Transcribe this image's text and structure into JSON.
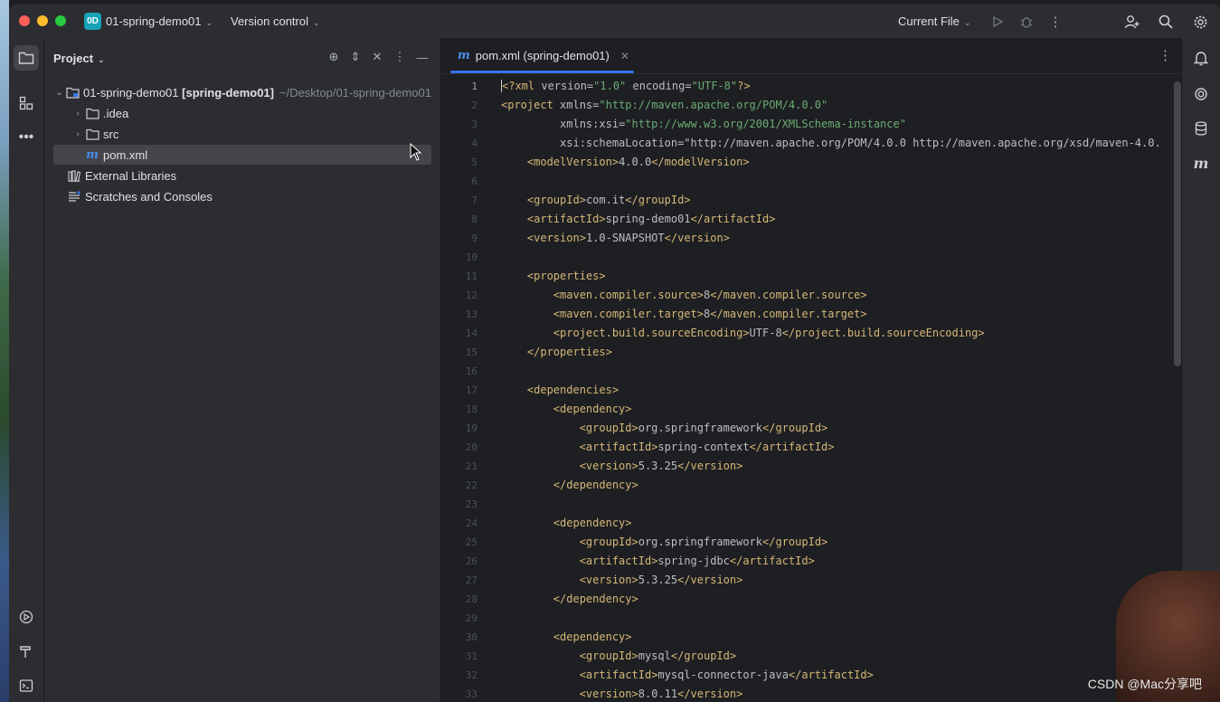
{
  "titlebar": {
    "project_badge": "0D",
    "project_name": "01-spring-demo01",
    "version_control": "Version control",
    "current_file": "Current File"
  },
  "panel": {
    "title": "Project",
    "tree": [
      {
        "label": "01-spring-demo01",
        "module": "[spring-demo01]",
        "path": "~/Desktop/01-spring-demo01"
      },
      {
        "label": ".idea"
      },
      {
        "label": "src"
      },
      {
        "label": "pom.xml"
      },
      {
        "label": "External Libraries"
      },
      {
        "label": "Scratches and Consoles"
      }
    ]
  },
  "editor": {
    "tab_label": "pom.xml (spring-demo01)",
    "line_numbers": [
      "1",
      "2",
      "3",
      "4",
      "5",
      "6",
      "7",
      "8",
      "9",
      "10",
      "11",
      "12",
      "13",
      "14",
      "15",
      "16",
      "17",
      "18",
      "19",
      "20",
      "21",
      "22",
      "23",
      "24",
      "25",
      "26",
      "27",
      "28",
      "29",
      "30",
      "31",
      "32",
      "33"
    ],
    "lines": [
      "<?xml version=\"1.0\" encoding=\"UTF-8\"?>",
      "<project xmlns=\"http://maven.apache.org/POM/4.0.0\"",
      "         xmlns:xsi=\"http://www.w3.org/2001/XMLSchema-instance\"",
      "         xsi:schemaLocation=\"http://maven.apache.org/POM/4.0.0 http://maven.apache.org/xsd/maven-4.0.",
      "    <modelVersion>4.0.0</modelVersion>",
      "",
      "    <groupId>com.it</groupId>",
      "    <artifactId>spring-demo01</artifactId>",
      "    <version>1.0-SNAPSHOT</version>",
      "",
      "    <properties>",
      "        <maven.compiler.source>8</maven.compiler.source>",
      "        <maven.compiler.target>8</maven.compiler.target>",
      "        <project.build.sourceEncoding>UTF-8</project.build.sourceEncoding>",
      "    </properties>",
      "",
      "    <dependencies>",
      "        <dependency>",
      "            <groupId>org.springframework</groupId>",
      "            <artifactId>spring-context</artifactId>",
      "            <version>5.3.25</version>",
      "        </dependency>",
      "",
      "        <dependency>",
      "            <groupId>org.springframework</groupId>",
      "            <artifactId>spring-jdbc</artifactId>",
      "            <version>5.3.25</version>",
      "        </dependency>",
      "",
      "        <dependency>",
      "            <groupId>mysql</groupId>",
      "            <artifactId>mysql-connector-java</artifactId>",
      "            <version>8.0.11</version>"
    ]
  },
  "watermark": "CSDN @Mac分享吧",
  "colors": {
    "accent": "#3574f0",
    "tag": "#d5b778",
    "string": "#6aab73",
    "badge": "#16a3b8"
  }
}
